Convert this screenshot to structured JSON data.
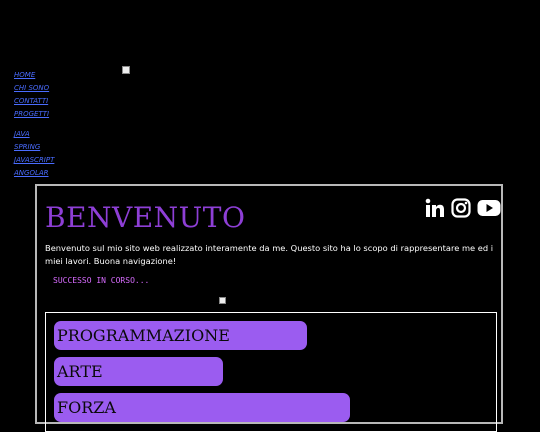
{
  "nav": {
    "primary": [
      {
        "label": "HOME"
      },
      {
        "label": "CHI SONO"
      },
      {
        "label": "CONTATTI"
      },
      {
        "label": "PROGETTI"
      }
    ],
    "secondary": [
      {
        "label": "JAVA"
      },
      {
        "label": "SPRING"
      },
      {
        "label": "JAVASCRIPT"
      },
      {
        "label": "ANGOLAR"
      }
    ]
  },
  "main": {
    "title": "BENVENUTO",
    "intro": "Benvenuto sul mio sito web realizzato interamente da me. Questo sito ha lo scopo di rappresentare me ed i miei lavori. Buona navigazione!",
    "status": "SUCCESSO IN CORSO...",
    "categories": [
      {
        "label": "PROGRAMMAZIONE"
      },
      {
        "label": "ARTE"
      },
      {
        "label": "FORZA"
      }
    ]
  },
  "social": {
    "icons": [
      "linkedin-icon",
      "instagram-icon",
      "youtube-icon"
    ]
  },
  "colors": {
    "background": "#000000",
    "link": "#4a6cff",
    "accent": "#8e3fd6",
    "pill": "#9b5cf0",
    "status": "#d86cff"
  }
}
